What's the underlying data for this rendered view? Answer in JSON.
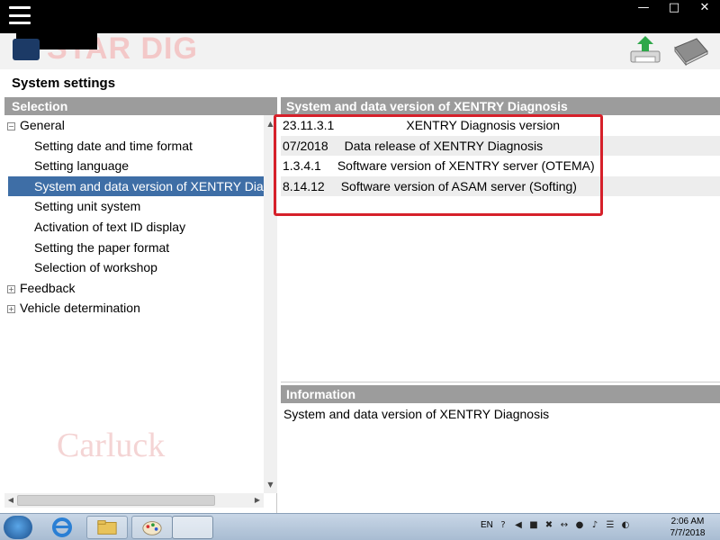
{
  "window": {
    "brand_text": "STAR DIG",
    "controls": {
      "minimize": "—",
      "maximize": "□",
      "close": "✕"
    }
  },
  "page": {
    "title": "System settings"
  },
  "selection": {
    "header": "Selection",
    "tree": [
      {
        "label": "General",
        "level": 0,
        "toggle": "−",
        "selected": false
      },
      {
        "label": "Setting date and time format",
        "level": 1,
        "selected": false
      },
      {
        "label": "Setting language",
        "level": 1,
        "selected": false
      },
      {
        "label": "System and data version of XENTRY Diagnosis",
        "level": 1,
        "selected": true
      },
      {
        "label": "Setting unit system",
        "level": 1,
        "selected": false
      },
      {
        "label": "Activation of text ID display",
        "level": 1,
        "selected": false
      },
      {
        "label": "Setting the paper format",
        "level": 1,
        "selected": false
      },
      {
        "label": "Selection of workshop",
        "level": 1,
        "selected": false
      },
      {
        "label": "Feedback",
        "level": 0,
        "toggle": "+",
        "selected": false
      },
      {
        "label": "Vehicle determination",
        "level": 0,
        "toggle": "+",
        "selected": false
      }
    ],
    "scroll": {
      "up": "▲",
      "down": "▼",
      "left": "◀",
      "right": "▶"
    }
  },
  "details": {
    "header": "System and data version of XENTRY Diagnosis",
    "rows": [
      {
        "value": "23.11.3.1",
        "description": "XENTRY Diagnosis version"
      },
      {
        "value": "07/2018",
        "description": "Data release of XENTRY Diagnosis"
      },
      {
        "value": "1.3.4.1",
        "description": "Software version of XENTRY server (OTEMA)"
      },
      {
        "value": "8.14.12",
        "description": "Software version of ASAM server (Softing)"
      }
    ]
  },
  "information": {
    "header": "Information",
    "text": "System and data version of XENTRY Diagnosis"
  },
  "watermark": "Carluck",
  "taskbar": {
    "language": "EN",
    "tray_icons": [
      "?",
      "◀",
      "■",
      "✖",
      "↔",
      "●",
      "♪",
      "☰",
      "◐"
    ],
    "time": "2:06 AM",
    "date": "7/7/2018"
  },
  "colors": {
    "header_gray": "#9c9c9c",
    "selection_blue": "#3e6ea6",
    "highlight_red": "#d6202a"
  }
}
